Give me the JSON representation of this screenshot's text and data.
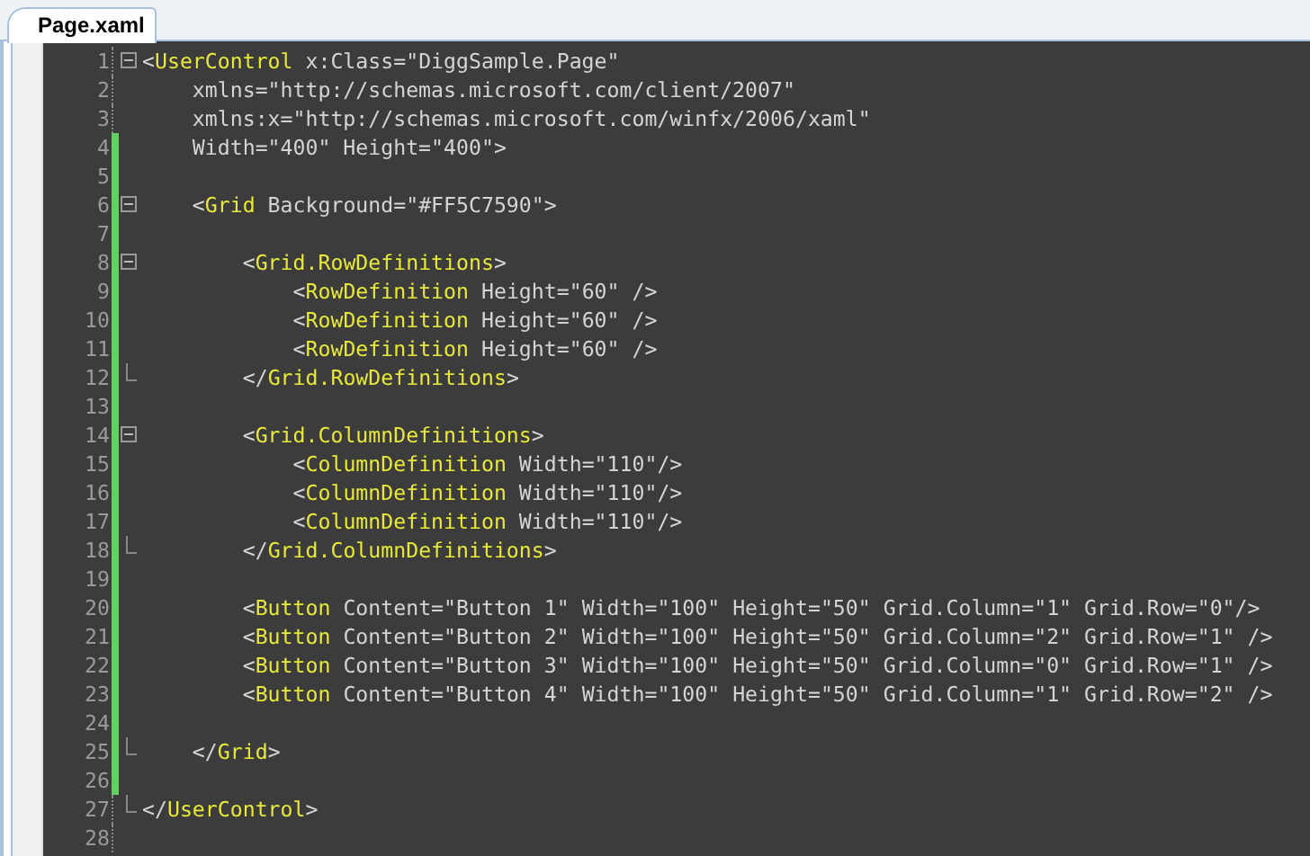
{
  "tab": {
    "label": "Page.xaml",
    "selected": true
  },
  "lines": [
    {
      "number": "1",
      "fold_start": true,
      "fold_end": false,
      "changed": false,
      "segments": [
        {
          "kind": "punct",
          "text": "<"
        },
        {
          "kind": "tag",
          "text": "UserControl"
        },
        {
          "kind": "attr",
          "text": " x:Class=\"DiggSample.Page\""
        }
      ]
    },
    {
      "number": "2",
      "fold_start": false,
      "fold_end": false,
      "changed": false,
      "segments": [
        {
          "kind": "attr",
          "text": "    xmlns=\"http://schemas.microsoft.com/client/2007\""
        }
      ]
    },
    {
      "number": "3",
      "fold_start": false,
      "fold_end": false,
      "changed": false,
      "segments": [
        {
          "kind": "attr",
          "text": "    xmlns:x=\"http://schemas.microsoft.com/winfx/2006/xaml\""
        }
      ]
    },
    {
      "number": "4",
      "fold_start": false,
      "fold_end": false,
      "changed": true,
      "segments": [
        {
          "kind": "attr",
          "text": "    Width=\"400\" Height=\"400\">"
        }
      ]
    },
    {
      "number": "5",
      "fold_start": false,
      "fold_end": false,
      "changed": true
    },
    {
      "number": "6",
      "fold_start": true,
      "fold_end": false,
      "changed": true,
      "segments": [
        {
          "kind": "punct",
          "text": "    <"
        },
        {
          "kind": "tag",
          "text": "Grid"
        },
        {
          "kind": "attr",
          "text": " Background=\"#FF5C7590\">"
        }
      ]
    },
    {
      "number": "7",
      "fold_start": false,
      "fold_end": false,
      "changed": true
    },
    {
      "number": "8",
      "fold_start": true,
      "fold_end": false,
      "changed": true,
      "segments": [
        {
          "kind": "punct",
          "text": "        <"
        },
        {
          "kind": "tag",
          "text": "Grid.RowDefinitions"
        },
        {
          "kind": "punct",
          "text": ">"
        }
      ]
    },
    {
      "number": "9",
      "fold_start": false,
      "fold_end": false,
      "changed": true,
      "segments": [
        {
          "kind": "punct",
          "text": "            <"
        },
        {
          "kind": "tag",
          "text": "RowDefinition"
        },
        {
          "kind": "attr",
          "text": " Height=\"60\" />"
        }
      ]
    },
    {
      "number": "10",
      "fold_start": false,
      "fold_end": false,
      "changed": true,
      "segments": [
        {
          "kind": "punct",
          "text": "            <"
        },
        {
          "kind": "tag",
          "text": "RowDefinition"
        },
        {
          "kind": "attr",
          "text": " Height=\"60\" />"
        }
      ]
    },
    {
      "number": "11",
      "fold_start": false,
      "fold_end": false,
      "changed": true,
      "segments": [
        {
          "kind": "punct",
          "text": "            <"
        },
        {
          "kind": "tag",
          "text": "RowDefinition"
        },
        {
          "kind": "attr",
          "text": " Height=\"60\" />"
        }
      ]
    },
    {
      "number": "12",
      "fold_start": false,
      "fold_end": true,
      "changed": true,
      "segments": [
        {
          "kind": "punct",
          "text": "        </"
        },
        {
          "kind": "tag",
          "text": "Grid.RowDefinitions"
        },
        {
          "kind": "punct",
          "text": ">"
        }
      ]
    },
    {
      "number": "13",
      "fold_start": false,
      "fold_end": false,
      "changed": true
    },
    {
      "number": "14",
      "fold_start": true,
      "fold_end": false,
      "changed": true,
      "segments": [
        {
          "kind": "punct",
          "text": "        <"
        },
        {
          "kind": "tag",
          "text": "Grid.ColumnDefinitions"
        },
        {
          "kind": "punct",
          "text": ">"
        }
      ]
    },
    {
      "number": "15",
      "fold_start": false,
      "fold_end": false,
      "changed": true,
      "segments": [
        {
          "kind": "punct",
          "text": "            <"
        },
        {
          "kind": "tag",
          "text": "ColumnDefinition"
        },
        {
          "kind": "attr",
          "text": " Width=\"110\"/>"
        }
      ]
    },
    {
      "number": "16",
      "fold_start": false,
      "fold_end": false,
      "changed": true,
      "segments": [
        {
          "kind": "punct",
          "text": "            <"
        },
        {
          "kind": "tag",
          "text": "ColumnDefinition"
        },
        {
          "kind": "attr",
          "text": " Width=\"110\"/>"
        }
      ]
    },
    {
      "number": "17",
      "fold_start": false,
      "fold_end": false,
      "changed": true,
      "segments": [
        {
          "kind": "punct",
          "text": "            <"
        },
        {
          "kind": "tag",
          "text": "ColumnDefinition"
        },
        {
          "kind": "attr",
          "text": " Width=\"110\"/>"
        }
      ]
    },
    {
      "number": "18",
      "fold_start": false,
      "fold_end": true,
      "changed": true,
      "segments": [
        {
          "kind": "punct",
          "text": "        </"
        },
        {
          "kind": "tag",
          "text": "Grid.ColumnDefinitions"
        },
        {
          "kind": "punct",
          "text": ">"
        }
      ]
    },
    {
      "number": "19",
      "fold_start": false,
      "fold_end": false,
      "changed": true
    },
    {
      "number": "20",
      "fold_start": false,
      "fold_end": false,
      "changed": true,
      "segments": [
        {
          "kind": "punct",
          "text": "        <"
        },
        {
          "kind": "tag",
          "text": "Button"
        },
        {
          "kind": "attr",
          "text": " Content=\"Button 1\" Width=\"100\" Height=\"50\" Grid.Column=\"1\" Grid.Row=\"0\"/>"
        }
      ]
    },
    {
      "number": "21",
      "fold_start": false,
      "fold_end": false,
      "changed": true,
      "segments": [
        {
          "kind": "punct",
          "text": "        <"
        },
        {
          "kind": "tag",
          "text": "Button"
        },
        {
          "kind": "attr",
          "text": " Content=\"Button 2\" Width=\"100\" Height=\"50\" Grid.Column=\"2\" Grid.Row=\"1\" />"
        }
      ]
    },
    {
      "number": "22",
      "fold_start": false,
      "fold_end": false,
      "changed": true,
      "segments": [
        {
          "kind": "punct",
          "text": "        <"
        },
        {
          "kind": "tag",
          "text": "Button"
        },
        {
          "kind": "attr",
          "text": " Content=\"Button 3\" Width=\"100\" Height=\"50\" Grid.Column=\"0\" Grid.Row=\"1\" />"
        }
      ]
    },
    {
      "number": "23",
      "fold_start": false,
      "fold_end": false,
      "changed": true,
      "segments": [
        {
          "kind": "punct",
          "text": "        <"
        },
        {
          "kind": "tag",
          "text": "Button"
        },
        {
          "kind": "attr",
          "text": " Content=\"Button 4\" Width=\"100\" Height=\"50\" Grid.Column=\"1\" Grid.Row=\"2\" />"
        }
      ]
    },
    {
      "number": "24",
      "fold_start": false,
      "fold_end": false,
      "changed": true
    },
    {
      "number": "25",
      "fold_start": false,
      "fold_end": true,
      "changed": true,
      "segments": [
        {
          "kind": "punct",
          "text": "    </"
        },
        {
          "kind": "tag",
          "text": "Grid"
        },
        {
          "kind": "punct",
          "text": ">"
        }
      ]
    },
    {
      "number": "26",
      "fold_start": false,
      "fold_end": false,
      "changed": true
    },
    {
      "number": "27",
      "fold_start": false,
      "fold_end": true,
      "changed": false,
      "segments": [
        {
          "kind": "punct",
          "text": "</"
        },
        {
          "kind": "tag",
          "text": "UserControl"
        },
        {
          "kind": "punct",
          "text": ">"
        }
      ]
    },
    {
      "number": "28",
      "fold_start": false,
      "fold_end": false,
      "changed": false
    }
  ]
}
